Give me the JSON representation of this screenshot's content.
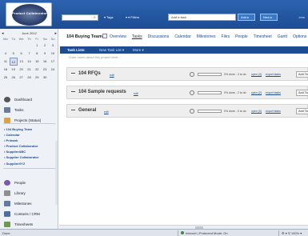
{
  "topbar": {
    "logo_text": "Product Collaborator",
    "search_placeholder": "",
    "tags_label": "▾ Tags",
    "filters_label": "▾ ▾ Filters",
    "add_task_placeholder": "Add a task",
    "add_button": "Add ▸",
    "new_button": "New ▸",
    "right_text": "ems"
  },
  "calendar": {
    "title": "June 2012",
    "prev": "◂",
    "next": "▸",
    "dow": [
      "Mo",
      "Tu",
      "We",
      "Th",
      "Fr",
      "Sa",
      "Su"
    ],
    "weeks": [
      [
        "",
        "",
        "",
        "",
        "1",
        "2",
        "3"
      ],
      [
        "4",
        "5",
        "6",
        "7",
        "8",
        "9",
        "10"
      ],
      [
        "11",
        "12",
        "13",
        "14",
        "15",
        "16",
        "17"
      ],
      [
        "18",
        "19",
        "20",
        "21",
        "22",
        "23",
        "24"
      ],
      [
        "25",
        "26",
        "27",
        "28",
        "29",
        "30",
        ""
      ]
    ]
  },
  "sidebar": {
    "nav": [
      {
        "label": "Dashboard",
        "color": "#555"
      },
      {
        "label": "Tasks",
        "color": "#6b7c99"
      },
      {
        "label": "Projects (Status)",
        "color": "#e0a33a"
      }
    ],
    "projects": [
      "• 104 Buying Team",
      "• Calendar",
      "• Primark",
      "• Product Collaborator",
      "• SupplierABC",
      "• Supplier Collaborator",
      "• SupplierXYZ"
    ],
    "bottom_nav": [
      {
        "label": "People",
        "color": "#7a5aa8"
      },
      {
        "label": "Library",
        "color": "#8f8f8f"
      },
      {
        "label": "Milestones",
        "color": "#5e7ca8"
      },
      {
        "label": "Contacts / CRM",
        "color": "#4f6f9e"
      },
      {
        "label": "Timesheets",
        "color": "#6a9a4a"
      }
    ]
  },
  "project": {
    "title": "104 Buying Team",
    "tabs": [
      "Overview",
      "Tasks",
      "Discussions",
      "Calendar",
      "Milestones",
      "Files",
      "People",
      "Timesheet",
      "Gantt",
      "Options"
    ],
    "active_tab": "Tasks"
  },
  "tasklist_bar": {
    "title": "Task Lists",
    "new_list": "New Task List ▾",
    "more": "More ▾"
  },
  "notes_placeholder": "Enter notes about this project here...",
  "tasklists": [
    {
      "name": "104 RFQs",
      "edit": "edit",
      "status": "0% done - 4 to do",
      "link1": "open (4)",
      "link2": "export tasks",
      "add": "Add Ta"
    },
    {
      "name": "104 Sample requests",
      "edit": "edit",
      "status": "0% done - 2 to do",
      "link1": "open (2)",
      "link2": "export tasks",
      "add": "Add Ta"
    },
    {
      "name": "General",
      "edit": "edit",
      "status": "0% done - 0 to do",
      "link1": "open (0)",
      "link2": "export tasks",
      "add": "Add Ta"
    }
  ],
  "statusbar": {
    "left": "Done",
    "zone": "Internet | Protected Mode: On",
    "zoom": "⚙ ▾  ⚲ 100% ▾"
  }
}
